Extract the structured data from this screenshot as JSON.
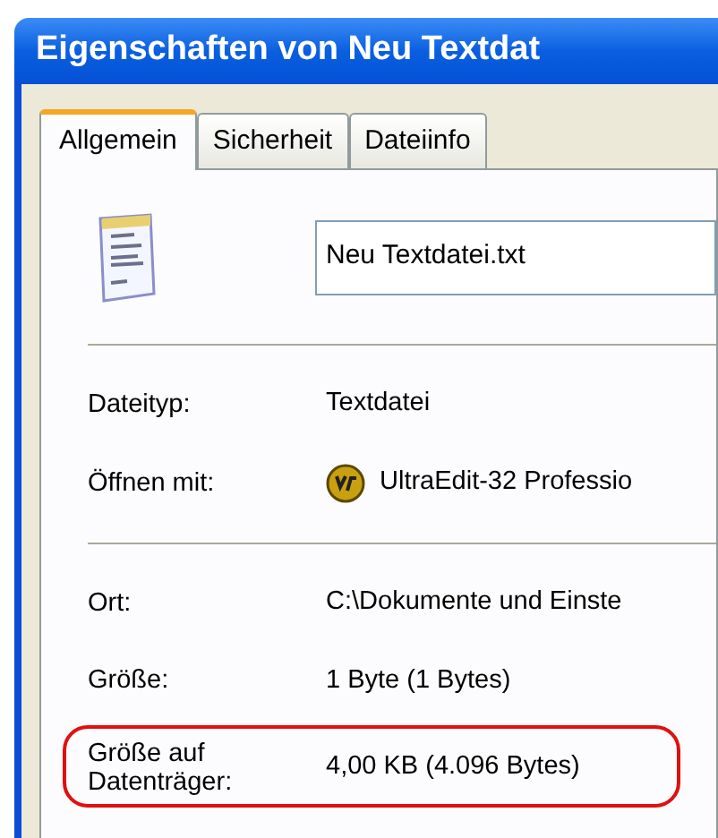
{
  "window": {
    "title": "Eigenschaften von Neu Textdat"
  },
  "tabs": [
    {
      "label": "Allgemein",
      "selected": true
    },
    {
      "label": "Sicherheit",
      "selected": false
    },
    {
      "label": "Dateiinfo",
      "selected": false
    }
  ],
  "file_name": {
    "value": "Neu Textdatei.txt"
  },
  "sections": [
    {
      "rows": [
        {
          "label": "Dateityp:",
          "value": "Textdatei",
          "kind": "text",
          "highlighted": false
        },
        {
          "label": "Öffnen mit:",
          "value": "UltraEdit-32 Professio",
          "kind": "app",
          "highlighted": false
        }
      ]
    },
    {
      "rows": [
        {
          "label": "Ort:",
          "value": "C:\\Dokumente und Einste",
          "kind": "text",
          "highlighted": false
        },
        {
          "label": "Größe:",
          "value": "1 Byte (1 Bytes)",
          "kind": "text",
          "highlighted": false
        },
        {
          "label": "Größe auf Datenträger:",
          "value": "4,00 KB (4.096 Bytes)",
          "kind": "text",
          "highlighted": true
        }
      ]
    }
  ]
}
